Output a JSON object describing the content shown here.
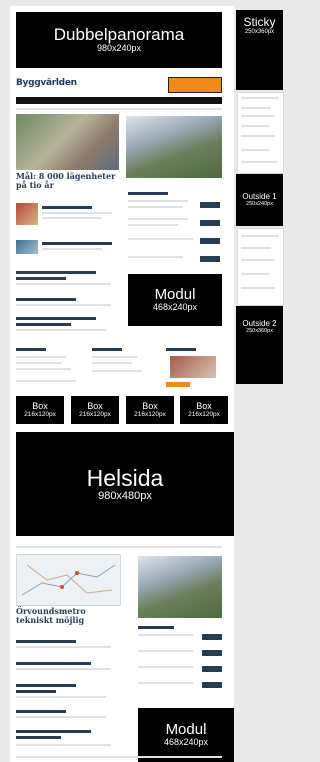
{
  "blocks": {
    "dubbel": {
      "title": "Dubbelpanorama",
      "size": "980x240px"
    },
    "sticky": {
      "title": "Sticky",
      "size": "250x360px"
    },
    "outside1": {
      "title": "Outside 1",
      "size": "250x240px"
    },
    "outside2": {
      "title": "Outside 2",
      "size": "250x360px"
    },
    "modul1": {
      "title": "Modul",
      "size": "468x240px"
    },
    "boxes": [
      {
        "title": "Box",
        "size": "216x120px"
      },
      {
        "title": "Box",
        "size": "216x120px"
      },
      {
        "title": "Box",
        "size": "216x120px"
      },
      {
        "title": "Box",
        "size": "216x120px"
      }
    ],
    "helsida": {
      "title": "Helsida",
      "size": "980x480px"
    },
    "modul2": {
      "title": "Modul",
      "size": "468x240px"
    }
  },
  "site": {
    "logo": "Byggvärlden",
    "headline1": "Mål: 8 000 lägenheter på tio år",
    "headline2": "Örvoundsmetro tekniskt möjlig"
  }
}
